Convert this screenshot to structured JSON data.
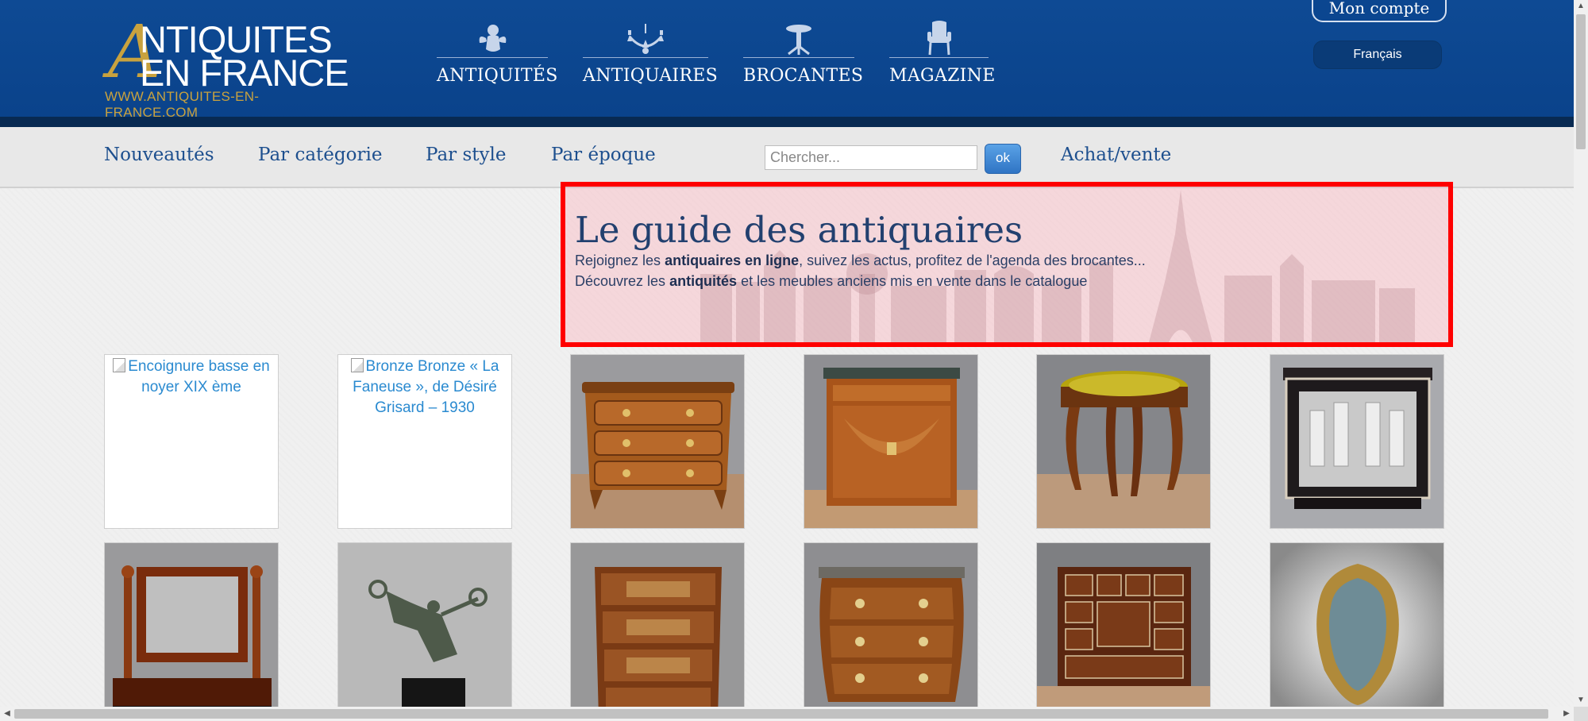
{
  "header": {
    "logo": {
      "line1": "NTIQUITES",
      "line2": "EN FRANCE",
      "initial": "A",
      "url": "WWW.ANTIQUITES-EN-FRANCE.COM"
    },
    "nav": [
      {
        "label": "ANTIQUITÉS",
        "icon": "cherub-icon"
      },
      {
        "label": "ANTIQUAIRES",
        "icon": "chandelier-icon"
      },
      {
        "label": "BROCANTES",
        "icon": "pedestal-table-icon"
      },
      {
        "label": "MAGAZINE",
        "icon": "armchair-icon"
      }
    ],
    "account_label": "Mon compte",
    "language": "Français"
  },
  "subnav": {
    "links": [
      "Nouveautés",
      "Par catégorie",
      "Par style",
      "Par époque"
    ],
    "search_placeholder": "Chercher...",
    "ok_label": "ok",
    "achat_label": "Achat/vente"
  },
  "guide": {
    "title": "Le guide des antiquaires",
    "line1_pre": "Rejoignez les ",
    "line1_bold": "antiquaires en ligne",
    "line1_post": ", suivez les actus, profitez de l'agenda des brocantes...",
    "line2_pre": "Découvrez les ",
    "line2_bold": "antiquités",
    "line2_post": " et les meubles anciens mis en vente dans le catalogue"
  },
  "products": [
    {
      "alt": "Encoignure basse en noyer XIX ème",
      "broken": true
    },
    {
      "alt": "Bronze Bronze « La Faneuse », de Désiré Grisard – 1930",
      "broken": true
    },
    {
      "alt": "Commode marquetée",
      "broken": false,
      "icon": "chest-of-drawers-icon"
    },
    {
      "alt": "Secrétaire en loupe",
      "broken": false,
      "icon": "secretary-desk-icon"
    },
    {
      "alt": "Tabouret jaune",
      "broken": false,
      "icon": "stool-icon"
    },
    {
      "alt": "Cave à liqueur",
      "broken": false,
      "icon": "liquor-cabinet-icon"
    },
    {
      "alt": "Psyché acajou",
      "broken": false,
      "icon": "dressing-mirror-icon"
    },
    {
      "alt": "Danseuse bronze",
      "broken": false,
      "icon": "dancer-sculpture-icon"
    },
    {
      "alt": "Chiffonnier marqueté",
      "broken": false,
      "icon": "tall-chest-icon"
    },
    {
      "alt": "Commode galbée",
      "broken": false,
      "icon": "bombe-commode-icon"
    },
    {
      "alt": "Cabinet incrusté",
      "broken": false,
      "icon": "inlaid-cabinet-icon"
    },
    {
      "alt": "Miroir doré",
      "broken": false,
      "icon": "gilt-mirror-icon"
    }
  ],
  "colors": {
    "header_blue": "#0b4690",
    "gold": "#c9a23e",
    "link_blue": "#1d4f8e",
    "highlight_border": "#ff0000"
  }
}
